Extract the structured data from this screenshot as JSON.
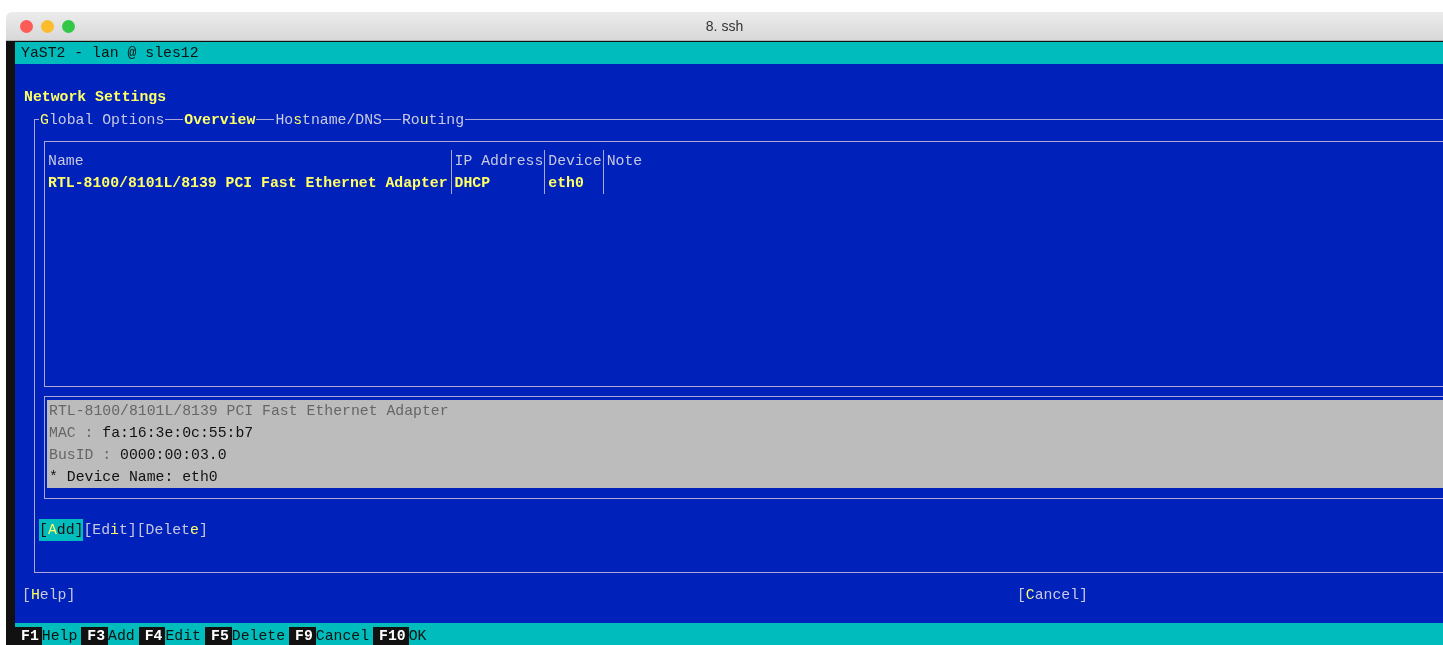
{
  "window": {
    "title": "8. ssh"
  },
  "terminal_title": "YaST2 - lan @ sles12",
  "heading": "Network Settings",
  "tabs": [
    {
      "key": "G",
      "post": "lobal Options",
      "selected": false
    },
    {
      "post": "Overview",
      "selected": true
    },
    {
      "pre": "Ho",
      "key": "s",
      "post": "tname/DNS",
      "selected": false
    },
    {
      "pre": "Ro",
      "key": "u",
      "post": "ting",
      "selected": false
    }
  ],
  "table": {
    "columns": [
      "Name",
      "IP Address",
      "Device",
      "Note"
    ],
    "rows": [
      {
        "selected": true,
        "cells": [
          "RTL-8100/8101L/8139 PCI Fast Ethernet Adapter",
          "DHCP",
          "eth0",
          ""
        ]
      }
    ]
  },
  "details": {
    "title": "RTL-8100/8101L/8139 PCI Fast Ethernet Adapter",
    "fields": [
      {
        "label": "MAC :",
        "value": "fa:16:3e:0c:55:b7"
      },
      {
        "label": "BusID :",
        "value": "0000:00:03.0"
      }
    ],
    "bullets": [
      {
        "marker": "*",
        "text": "Device Name: eth0"
      }
    ]
  },
  "actions": [
    {
      "pre": "[",
      "key": "A",
      "post": "dd]",
      "selected": true
    },
    {
      "pre": "[Ed",
      "key": "i",
      "post": "t]",
      "selected": false
    },
    {
      "pre": "[Delet",
      "key": "e",
      "post": "]",
      "selected": false
    }
  ],
  "footer_buttons": [
    {
      "pre": "[",
      "key": "H",
      "post": "elp]"
    },
    {
      "pre": "[",
      "key": "C",
      "post": "ancel]"
    }
  ],
  "function_keys": [
    {
      "key": "F1",
      "label": "Help"
    },
    {
      "key": "F3",
      "label": "Add"
    },
    {
      "key": "F4",
      "label": "Edit"
    },
    {
      "key": "F5",
      "label": "Delete"
    },
    {
      "key": "F9",
      "label": "Cancel"
    },
    {
      "key": "F10",
      "label": "OK"
    }
  ]
}
